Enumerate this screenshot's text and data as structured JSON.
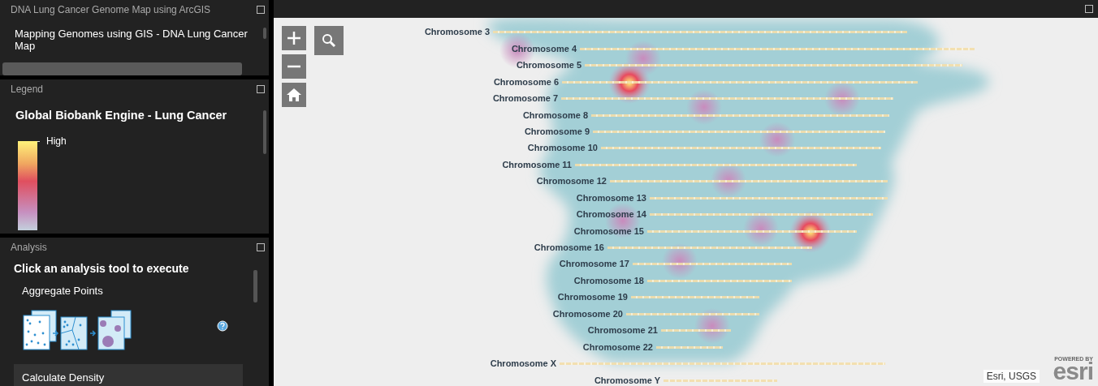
{
  "app_panel": {
    "title": "DNA Lung Cancer Genome Map using ArcGIS",
    "text": "Mapping Genomes using GIS - DNA Lung Cancer Map"
  },
  "legend": {
    "title": "Legend",
    "layer": "Global Biobank Engine - Lung Cancer",
    "high_label": "High"
  },
  "analysis": {
    "title": "Analysis",
    "heading": "Click an analysis tool to execute",
    "tools": [
      {
        "name": "Aggregate Points",
        "expanded": true,
        "selected": false
      },
      {
        "name": "Calculate Density",
        "expanded": false,
        "selected": true
      }
    ]
  },
  "map": {
    "labels": [
      "Chromosome 3",
      "Chromosome 4",
      "Chromosome 5",
      "Chromosome 6",
      "Chromosome 7",
      "Chromosome 8",
      "Chromosome 9",
      "Chromosome 10",
      "Chromosome 11",
      "Chromosome 12",
      "Chromosome 13",
      "Chromosome 14",
      "Chromosome 15",
      "Chromosome 16",
      "Chromosome 17",
      "Chromosome 18",
      "Chromosome 19",
      "Chromosome 20",
      "Chromosome 21",
      "Chromosome 22",
      "Chromosome X",
      "Chromosome Y"
    ],
    "attribution": "Esri, USGS",
    "logo_caption": "POWERED BY",
    "logo": "esri"
  }
}
